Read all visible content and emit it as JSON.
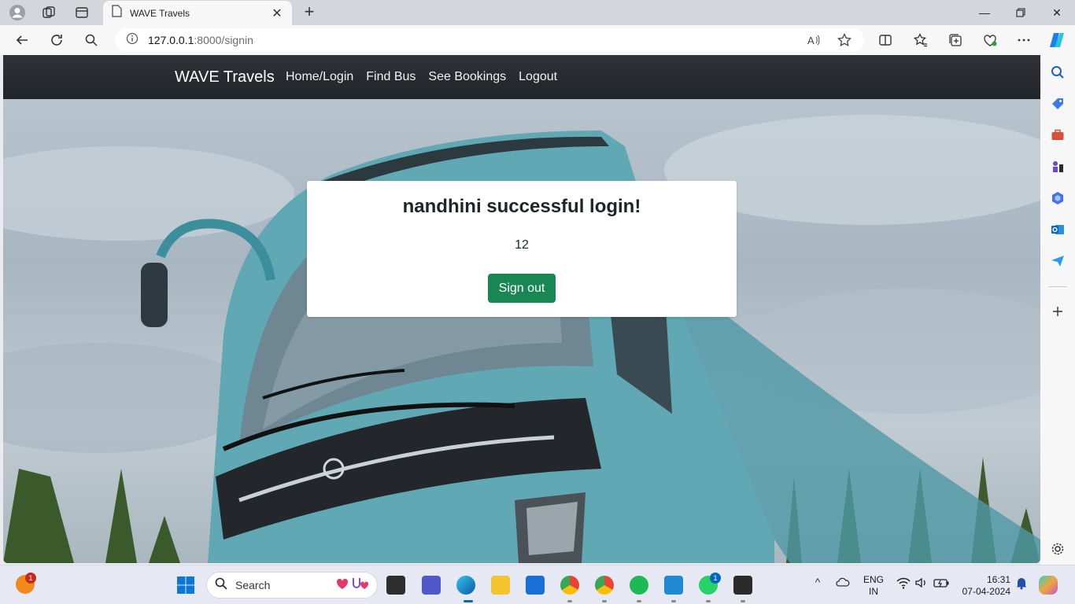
{
  "browser": {
    "tab_title": "WAVE Travels",
    "url_host": "127.0.0.1",
    "url_rest": ":8000/signin"
  },
  "page": {
    "navbar": {
      "brand": "WAVE Travels",
      "links": [
        "Home/Login",
        "Find Bus",
        "See Bookings",
        "Logout"
      ]
    },
    "card": {
      "title": "nandhini successful login!",
      "number": "12",
      "signout_label": "Sign out"
    }
  },
  "taskbar": {
    "search_placeholder": "Search",
    "lang_line1": "ENG",
    "lang_line2": "IN",
    "time": "16:31",
    "date": "07-04-2024",
    "notification_badge": "1",
    "whatsapp_badge": "1"
  },
  "colors": {
    "navbar": "#212529",
    "signout": "#198754",
    "card": "#ffffff"
  }
}
